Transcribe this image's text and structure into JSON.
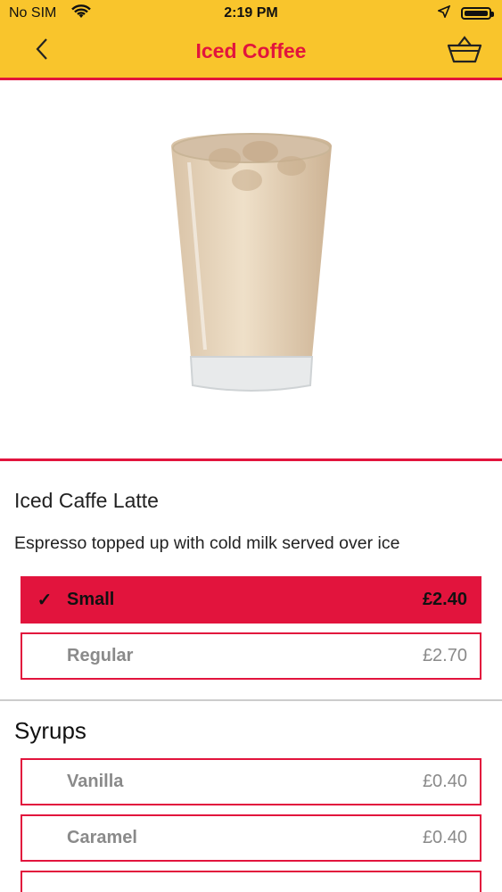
{
  "status_bar": {
    "carrier": "No SIM",
    "time": "2:19 PM"
  },
  "header": {
    "title": "Iced Coffee",
    "back_icon": "chevron-left-icon",
    "basket_icon": "basket-icon"
  },
  "product": {
    "name": "Iced Caffe Latte",
    "description": "Espresso topped up with cold milk served over ice"
  },
  "sizes": [
    {
      "label": "Small",
      "price": "£2.40",
      "selected": true,
      "check": "✓"
    },
    {
      "label": "Regular",
      "price": "£2.70",
      "selected": false,
      "check": ""
    }
  ],
  "syrups": {
    "title": "Syrups",
    "items": [
      {
        "label": "Vanilla",
        "price": "£0.40"
      },
      {
        "label": "Caramel",
        "price": "£0.40"
      }
    ]
  },
  "colors": {
    "header_bg": "#f9c52c",
    "accent": "#e2143d"
  }
}
